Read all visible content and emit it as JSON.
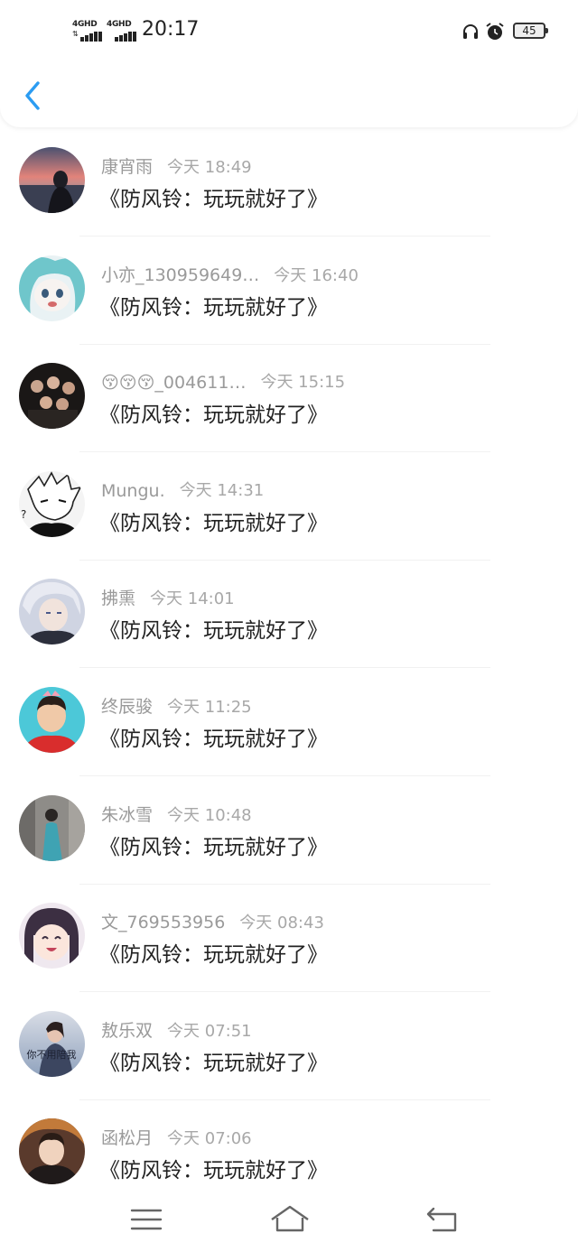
{
  "status_bar": {
    "network_1": "4GHD",
    "network_2": "4GHD",
    "time": "20:17",
    "battery": "45",
    "icons": [
      "headphones-icon",
      "alarm-icon",
      "battery-icon"
    ]
  },
  "header": {
    "back_icon": "chevron-left-icon",
    "accent": "#2b9cf2"
  },
  "list": [
    {
      "name": "康宵雨",
      "time": "今天 18:49",
      "message": "《防风铃：玩玩就好了》",
      "avatar": "sunset-silhouette"
    },
    {
      "name": "小亦_130959649…",
      "time": "今天 16:40",
      "message": "《防风铃：玩玩就好了》",
      "avatar": "anime-teal-hair"
    },
    {
      "name": "😚😚😚_004611…",
      "time": "今天 15:15",
      "message": "《防风铃：玩玩就好了》",
      "avatar": "group-photo"
    },
    {
      "name": "Mungu.",
      "time": "今天 14:31",
      "message": "《防风铃：玩玩就好了》",
      "avatar": "manga-sketch"
    },
    {
      "name": "拂熏",
      "time": "今天 14:01",
      "message": "《防风铃：玩玩就好了》",
      "avatar": "anime-silver-hair"
    },
    {
      "name": "终辰骏",
      "time": "今天 11:25",
      "message": "《防风铃：玩玩就好了》",
      "avatar": "child-cyan-bg"
    },
    {
      "name": "朱冰雪",
      "time": "今天 10:48",
      "message": "《防风铃：玩玩就好了》",
      "avatar": "girl-teal-dress"
    },
    {
      "name": "文_769553956",
      "time": "今天 08:43",
      "message": "《防风铃：玩玩就好了》",
      "avatar": "anime-smiling-girl"
    },
    {
      "name": "敖乐双",
      "time": "今天 07:51",
      "message": "《防风铃：玩玩就好了》",
      "avatar": "girl-with-text",
      "avatar_text": "你不用陪我"
    },
    {
      "name": "函松月",
      "time": "今天 07:06",
      "message": "《防风铃：玩玩就好了》",
      "avatar": "anime-dark-warrior"
    }
  ],
  "nav_bar": {
    "icons": [
      "menu-icon",
      "home-icon",
      "back-icon"
    ]
  }
}
